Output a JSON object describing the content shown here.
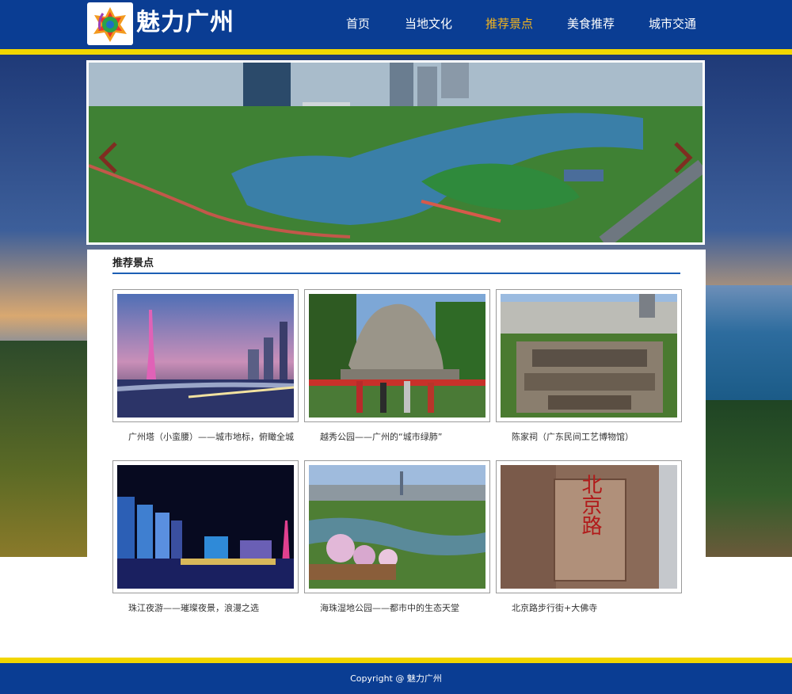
{
  "header": {
    "site_title": "魅力广州",
    "logo_icon": "guangzhou-logo-icon",
    "nav": [
      {
        "label": "首页",
        "active": false
      },
      {
        "label": "当地文化",
        "active": false
      },
      {
        "label": "推荐景点",
        "active": true
      },
      {
        "label": "美食推荐",
        "active": false
      },
      {
        "label": "城市交通",
        "active": false
      }
    ]
  },
  "banner": {
    "prev_icon": "chevron-left-icon",
    "next_icon": "chevron-right-icon"
  },
  "section": {
    "title": "推荐景点",
    "attractions": [
      {
        "caption": "广州塔（小蛮腰）——城市地标，俯瞰全城"
      },
      {
        "caption": "越秀公园——广州的“城市绿肺”"
      },
      {
        "caption": "陈家祠（广东民间工艺博物馆）"
      },
      {
        "caption": "珠江夜游——璀璨夜景，浪漫之选"
      },
      {
        "caption": "海珠湿地公园——都市中的生态天堂"
      },
      {
        "caption": "北京路步行街+大佛寺"
      }
    ],
    "sign_text": "北京路"
  },
  "footer": {
    "copyright": "Copyright @ 魅力广州"
  },
  "colors": {
    "header_bg": "#0a3d93",
    "stripe": "#f2d600",
    "nav_active": "#f5b51c",
    "section_rule": "#1c5fb5"
  }
}
